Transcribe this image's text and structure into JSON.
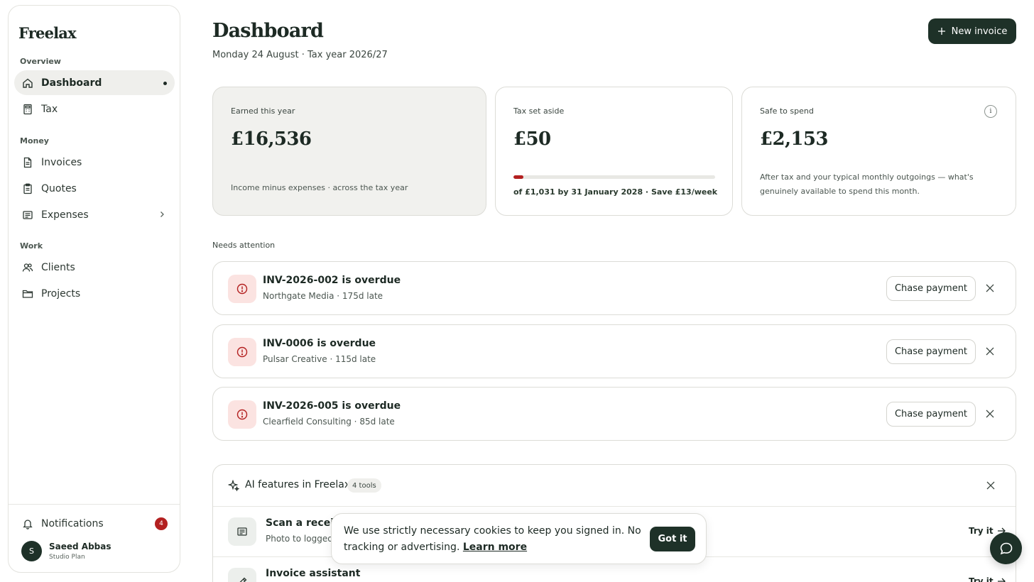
{
  "app": {
    "name": "Freelax"
  },
  "sidebar": {
    "sections": {
      "overview": "Overview",
      "money": "Money",
      "work": "Work"
    },
    "items": [
      {
        "label": "Dashboard",
        "icon": "home-icon",
        "active": true
      },
      {
        "label": "Tax",
        "icon": "calculator-icon"
      },
      {
        "label": "Invoices",
        "icon": "document-icon"
      },
      {
        "label": "Quotes",
        "icon": "clipboard-icon"
      },
      {
        "label": "Expenses",
        "icon": "receipt-icon",
        "has_submenu": true
      },
      {
        "label": "Clients",
        "icon": "users-icon"
      },
      {
        "label": "Projects",
        "icon": "folder-icon"
      }
    ],
    "notifications": {
      "label": "Notifications",
      "count": "4"
    },
    "user": {
      "initial": "S",
      "name": "Saeed Abbas",
      "plan": "Studio Plan"
    }
  },
  "header": {
    "title": "Dashboard",
    "subtitle": "Monday 24 August · Tax year 2026/27",
    "new_invoice_label": "New invoice"
  },
  "stats": {
    "earned": {
      "label": "Earned this year",
      "value": "£16,536",
      "description": "Income minus expenses · across the tax year"
    },
    "tax": {
      "label": "Tax set aside",
      "value": "£50",
      "progress_fraction": 0.05,
      "progress_text": "of £1,031 by 31 January 2028 · Save £13/week"
    },
    "safe": {
      "label": "Safe to spend",
      "value": "£2,153",
      "info_glyph": "i",
      "description": "After tax and your typical monthly outgoings — what's genuinely available to spend this month."
    }
  },
  "attention": {
    "label": "Needs attention",
    "alerts": [
      {
        "title": "INV-2026-002 is overdue",
        "subtitle": "Northgate Media · 175d late",
        "action": "Chase payment"
      },
      {
        "title": "INV-0006 is overdue",
        "subtitle": "Pulsar Creative · 115d late",
        "action": "Chase payment"
      },
      {
        "title": "INV-2026-005 is overdue",
        "subtitle": "Clearfield Consulting · 85d late",
        "action": "Chase payment"
      }
    ]
  },
  "ai": {
    "title": "AI features in Freelax",
    "count": "4 tools",
    "tools": [
      {
        "title": "Scan a receipt",
        "subtitle": "Photo to logged e",
        "action": "Try it"
      },
      {
        "title": "Invoice assistant",
        "subtitle": "",
        "action": "Try it"
      }
    ]
  },
  "cookie": {
    "text": "We use strictly necessary cookies to keep you signed in. No tracking or advertising.",
    "link": "Learn more",
    "button": "Got it"
  },
  "colors": {
    "primary": "#1e3128",
    "danger": "#b32020",
    "danger_bg": "#fbe3e1",
    "card_muted_bg": "#f1f1ee"
  }
}
